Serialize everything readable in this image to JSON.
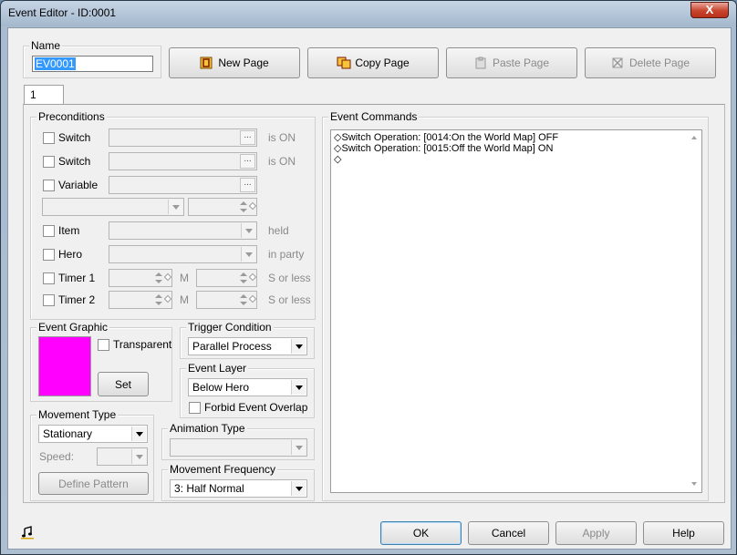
{
  "window": {
    "title": "Event Editor - ID:0001",
    "close_glyph": "X"
  },
  "name_group": {
    "label": "Name",
    "value": "EV0001"
  },
  "page_buttons": {
    "new_page": "New Page",
    "copy_page": "Copy Page",
    "paste_page": "Paste Page",
    "delete_page": "Delete Page"
  },
  "tabs": [
    {
      "label": "1"
    }
  ],
  "preconditions": {
    "label": "Preconditions",
    "switch1": {
      "label": "Switch",
      "suffix": "is ON"
    },
    "switch2": {
      "label": "Switch",
      "suffix": "is ON"
    },
    "variable": {
      "label": "Variable"
    },
    "item": {
      "label": "Item",
      "suffix": "held"
    },
    "hero": {
      "label": "Hero",
      "suffix": "in party"
    },
    "timer1": {
      "label": "Timer 1",
      "unit_m": "M",
      "suffix": "S or less"
    },
    "timer2": {
      "label": "Timer 2",
      "unit_m": "M",
      "suffix": "S or less"
    },
    "ellipsis": "..."
  },
  "event_graphic": {
    "label": "Event Graphic",
    "transparent_label": "Transparent",
    "set_button": "Set",
    "swatch_color": "#ff00ff"
  },
  "trigger_condition": {
    "label": "Trigger Condition",
    "value": "Parallel Process"
  },
  "event_layer": {
    "label": "Event Layer",
    "value": "Below Hero",
    "forbid_overlap_label": "Forbid Event Overlap"
  },
  "movement_type": {
    "label": "Movement Type",
    "value": "Stationary",
    "speed_label": "Speed:",
    "define_pattern_button": "Define Pattern"
  },
  "animation_type": {
    "label": "Animation Type",
    "value": ""
  },
  "movement_frequency": {
    "label": "Movement Frequency",
    "value": "3: Half Normal"
  },
  "event_commands": {
    "label": "Event Commands",
    "lines": [
      "◇Switch Operation: [0014:On the World Map] OFF",
      "◇Switch Operation: [0015:Off the World Map] ON",
      "◇"
    ]
  },
  "footer": {
    "ok": "OK",
    "cancel": "Cancel",
    "apply": "Apply",
    "help": "Help",
    "music_icon": "music-note-icon"
  }
}
